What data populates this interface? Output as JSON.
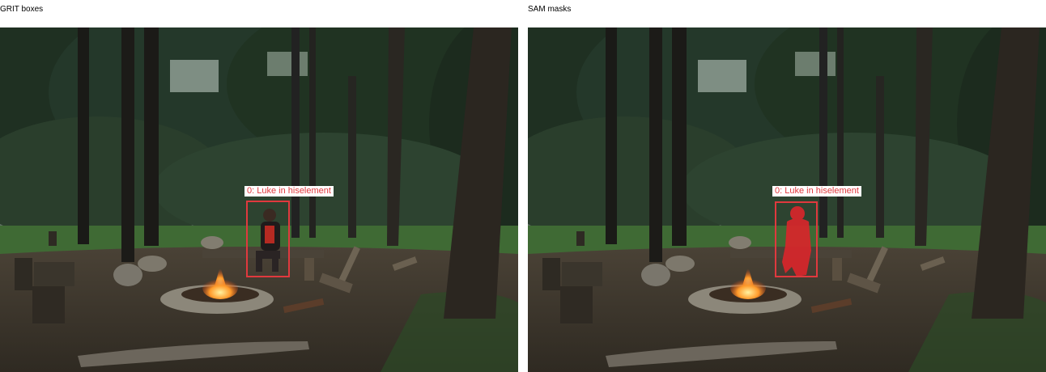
{
  "panels": [
    {
      "title": "GRIT boxes",
      "label": "0: Luke in hiselement",
      "mask": false
    },
    {
      "title": "SAM masks",
      "label": "0: Luke in hiselement",
      "mask": true
    }
  ],
  "colors": {
    "box": "#e0393e",
    "mask": "#d8262b"
  }
}
